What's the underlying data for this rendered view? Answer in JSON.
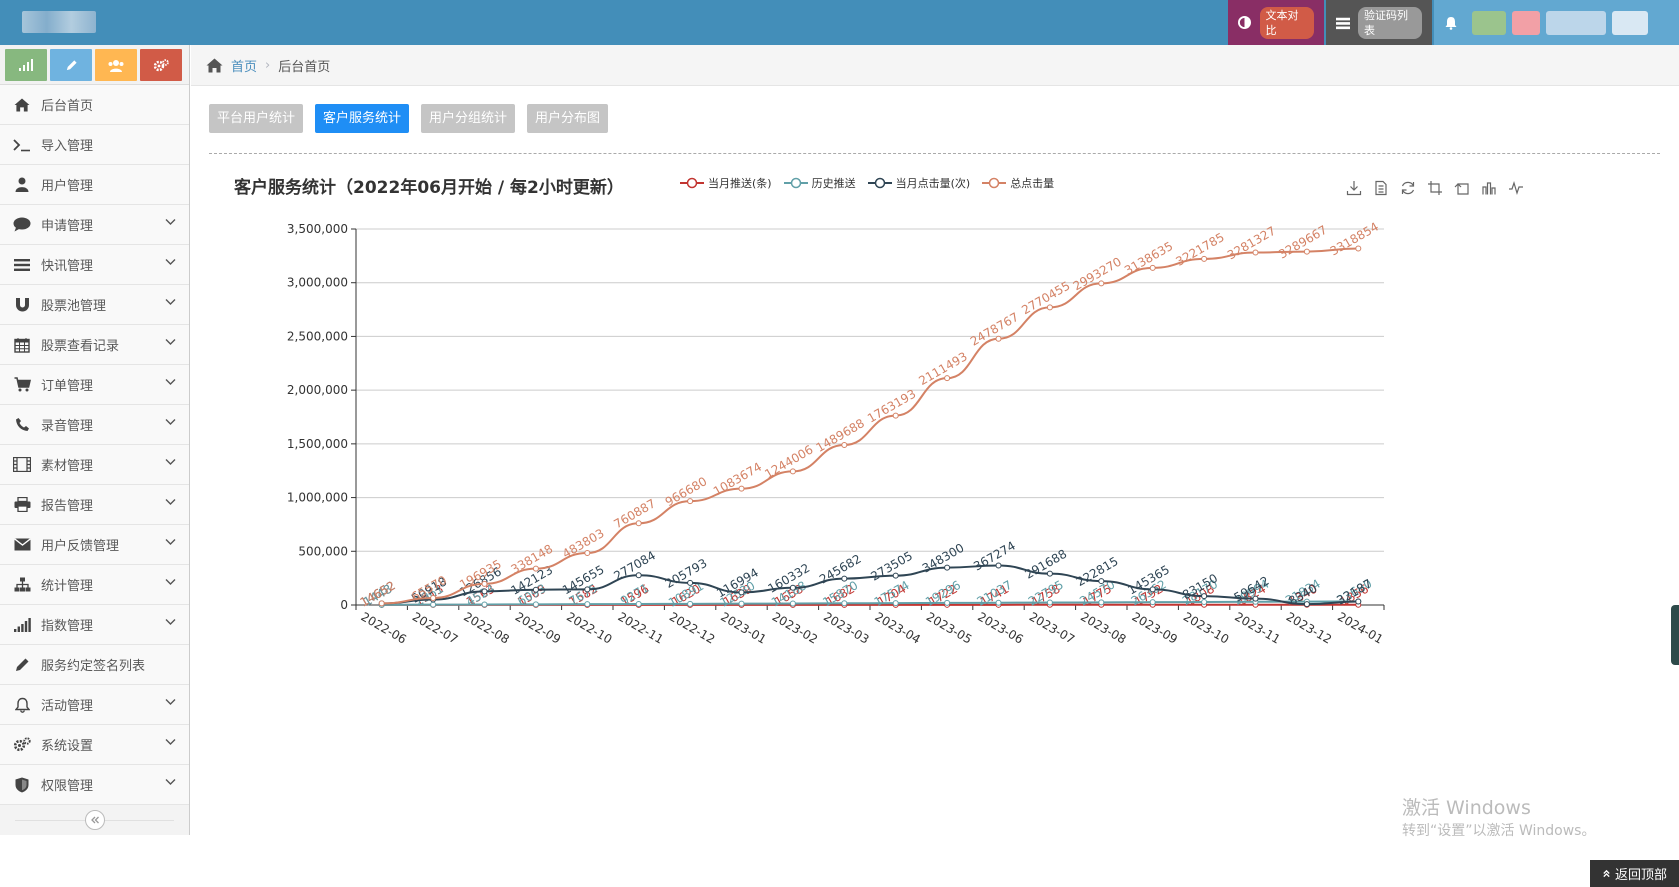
{
  "top": {
    "compare_label": "文本对比",
    "captcha_label": "验证码列表"
  },
  "sidebar": {
    "items": [
      {
        "label": "后台首页",
        "icon": "home-icon",
        "has_children": false
      },
      {
        "label": "导入管理",
        "icon": "terminal-icon",
        "has_children": false
      },
      {
        "label": "用户管理",
        "icon": "user-icon",
        "has_children": false
      },
      {
        "label": "申请管理",
        "icon": "comment-icon",
        "has_children": true
      },
      {
        "label": "快讯管理",
        "icon": "list-icon",
        "has_children": true
      },
      {
        "label": "股票池管理",
        "icon": "magnet-icon",
        "has_children": true
      },
      {
        "label": "股票查看记录",
        "icon": "calendar-icon",
        "has_children": true
      },
      {
        "label": "订单管理",
        "icon": "cart-icon",
        "has_children": true
      },
      {
        "label": "录音管理",
        "icon": "phone-icon",
        "has_children": true
      },
      {
        "label": "素材管理",
        "icon": "film-icon",
        "has_children": true
      },
      {
        "label": "报告管理",
        "icon": "print-icon",
        "has_children": true
      },
      {
        "label": "用户反馈管理",
        "icon": "envelope-icon",
        "has_children": true
      },
      {
        "label": "统计管理",
        "icon": "sitemap-icon",
        "has_children": true
      },
      {
        "label": "指数管理",
        "icon": "signal-icon",
        "has_children": true
      },
      {
        "label": "服务约定签名列表",
        "icon": "pencil-icon",
        "has_children": false
      },
      {
        "label": "活动管理",
        "icon": "bell-icon",
        "has_children": true
      },
      {
        "label": "系统设置",
        "icon": "cogs-icon",
        "has_children": true
      },
      {
        "label": "权限管理",
        "icon": "shield-icon",
        "has_children": true
      }
    ]
  },
  "breadcrumb": {
    "home": "首页",
    "current": "后台首页"
  },
  "tabs": [
    {
      "label": "平台用户统计",
      "active": false
    },
    {
      "label": "客户服务统计",
      "active": true
    },
    {
      "label": "用户分组统计",
      "active": false
    },
    {
      "label": "用户分布图",
      "active": false
    }
  ],
  "chart_data": {
    "type": "line",
    "title": "客户服务统计（2022年06月开始 / 每2小时更新）",
    "categories": [
      "2022-06",
      "2022-07",
      "2022-08",
      "2022-09",
      "2022-10",
      "2022-11",
      "2022-12",
      "2023-01",
      "2023-02",
      "2023-03",
      "2023-04",
      "2023-05",
      "2023-06",
      "2023-07",
      "2023-08",
      "2023-09",
      "2023-10",
      "2023-11",
      "2023-12",
      "2024-01"
    ],
    "y_ticks": [
      "0",
      "500,000",
      "1,000,000",
      "1,500,000",
      "2,000,000",
      "2,500,000",
      "3,000,000",
      "3,500,000"
    ],
    "ylim": [
      0,
      3500000
    ],
    "grid": true,
    "legend_position": "top",
    "series": [
      {
        "name": "当月推送(条)",
        "color": "#c23531",
        "values": [
          1448,
          1513,
          1563,
          1569,
          1582,
          1596,
          1620,
          1639,
          1658,
          1682,
          1704,
          1722,
          1741,
          1758,
          1775,
          1792,
          1808,
          1824,
          1840,
          1856
        ]
      },
      {
        "name": "历史推送",
        "color": "#61a0a8",
        "values": [
          1448,
          2961,
          4524,
          6093,
          7675,
          9271,
          10891,
          12530,
          14188,
          15870,
          17574,
          19296,
          21037,
          22795,
          24570,
          26362,
          28170,
          29994,
          31834,
          33690
        ]
      },
      {
        "name": "当月点击量(次)",
        "color": "#2f4554",
        "values": [
          14652,
          50918,
          126856,
          142123,
          145655,
          277084,
          205793,
          116994,
          160332,
          245682,
          273505,
          348300,
          367274,
          291688,
          222815,
          145365,
          83150,
          59642,
          8340,
          32187
        ]
      },
      {
        "name": "总点击量",
        "color": "#d48265",
        "values": [
          14652,
          65570,
          196935,
          338148,
          483803,
          760887,
          966680,
          1083674,
          1244006,
          1489688,
          1763193,
          2111493,
          2478767,
          2770455,
          2993270,
          3138635,
          3221785,
          3281327,
          3289667,
          3318854
        ]
      }
    ]
  },
  "watermark": {
    "line1": "激活 Windows",
    "line2": "转到“设置”以激活 Windows。"
  },
  "backtop_label": "返回顶部"
}
